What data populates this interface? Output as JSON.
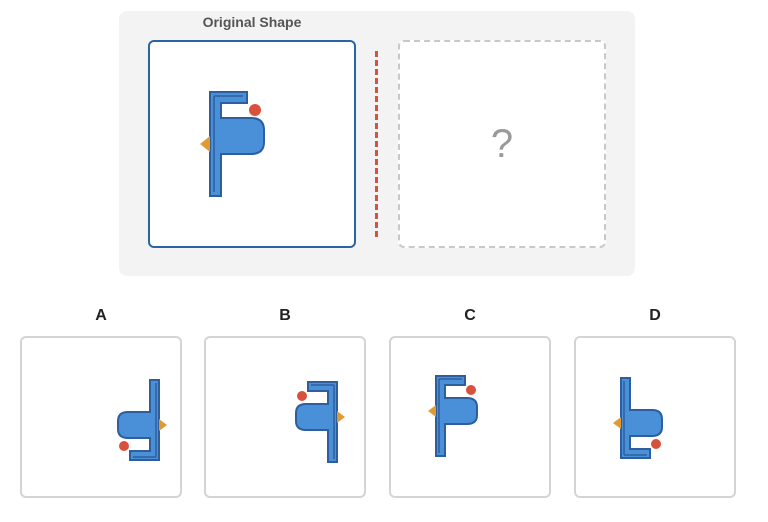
{
  "puzzle": {
    "title": "Original Shape",
    "unknown_symbol": "?",
    "colors": {
      "shape_fill": "#4a90d9",
      "shape_stroke": "#2e5e9e",
      "dot": "#d9503d",
      "arrow": "#e09b30",
      "mirror_line": "#d9503d"
    }
  },
  "options": [
    {
      "label": "A",
      "transform": "rotate-180"
    },
    {
      "label": "B",
      "transform": "mirror-horizontal"
    },
    {
      "label": "C",
      "transform": "identity"
    },
    {
      "label": "D",
      "transform": "mirror-vertical"
    }
  ]
}
